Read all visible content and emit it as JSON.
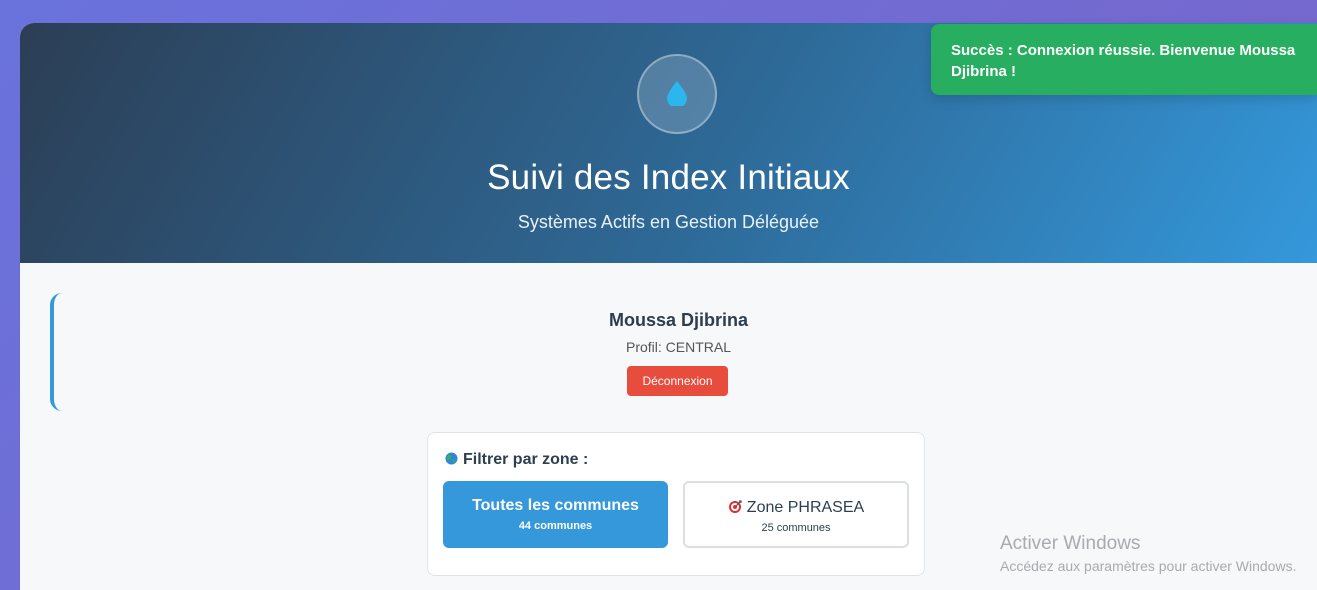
{
  "header": {
    "title": "Suivi des Index Initiaux",
    "subtitle": "Systèmes Actifs en Gestion Déléguée",
    "logo_icon": "water-drop-icon"
  },
  "toast": {
    "message": "Succès : Connexion réussie. Bienvenue Moussa Djibrina !",
    "color": "#27ae60"
  },
  "user": {
    "name": "Moussa Djibrina",
    "profile": "Profil: CENTRAL",
    "logout_label": "Déconnexion"
  },
  "filter": {
    "title": "Filtrer par zone :",
    "title_icon": "globe-icon",
    "zones": [
      {
        "name": "Toutes les communes",
        "count": "44 communes",
        "active": true
      },
      {
        "name": "Zone PHRASEA",
        "count": "25 communes",
        "icon": "target-icon",
        "active": false
      }
    ]
  },
  "watermark": {
    "title": "Activer Windows",
    "subtitle": "Accédez aux paramètres pour activer Windows."
  },
  "colors": {
    "accent": "#3498db",
    "danger": "#e74c3c",
    "success": "#27ae60"
  }
}
